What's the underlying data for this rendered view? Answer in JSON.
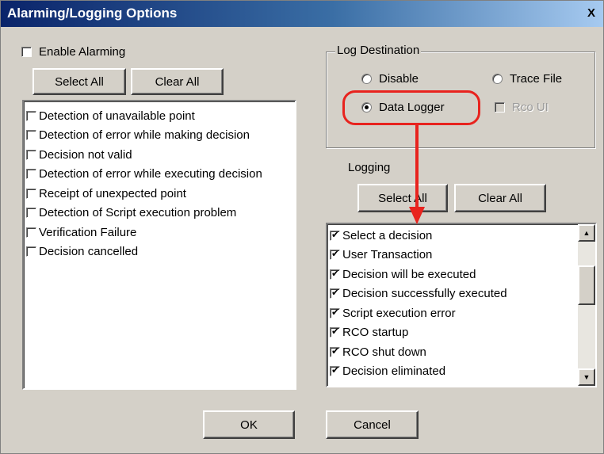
{
  "window": {
    "title": "Alarming/Logging Options",
    "close_glyph": "X"
  },
  "alarming": {
    "enable_label": "Enable Alarming",
    "enable_checked": false,
    "select_all_label": "Select All",
    "clear_all_label": "Clear All",
    "items": [
      {
        "label": "Detection of unavailable point",
        "checked": false
      },
      {
        "label": "Detection of error while making decision",
        "checked": false
      },
      {
        "label": "Decision not valid",
        "checked": false
      },
      {
        "label": "Detection of error while executing decision",
        "checked": false
      },
      {
        "label": "Receipt of unexpected point",
        "checked": false
      },
      {
        "label": "Detection of Script execution problem",
        "checked": false
      },
      {
        "label": "Verification Failure",
        "checked": false
      },
      {
        "label": "Decision cancelled",
        "checked": false
      }
    ]
  },
  "log_destination": {
    "group_label": "Log Destination",
    "options": {
      "disable": {
        "label": "Disable",
        "selected": false
      },
      "trace_file": {
        "label": "Trace File",
        "selected": false
      },
      "data_logger": {
        "label": "Data Logger",
        "selected": true
      }
    },
    "rco_ui": {
      "label": "Rco UI",
      "checked": false,
      "enabled": false
    }
  },
  "logging": {
    "label": "Logging",
    "select_all_label": "Select All",
    "clear_all_label": "Clear All",
    "items": [
      {
        "label": "Select a decision",
        "checked": true
      },
      {
        "label": "User Transaction",
        "checked": true
      },
      {
        "label": "Decision will be executed",
        "checked": true
      },
      {
        "label": "Decision successfully executed",
        "checked": true
      },
      {
        "label": "Script execution error",
        "checked": true
      },
      {
        "label": "RCO startup",
        "checked": true
      },
      {
        "label": "RCO shut down",
        "checked": true
      },
      {
        "label": "Decision eliminated",
        "checked": true
      }
    ]
  },
  "footer": {
    "ok_label": "OK",
    "cancel_label": "Cancel"
  },
  "colors": {
    "title_start": "#0a246a",
    "title_end": "#a6caf0",
    "face": "#d4d0c8",
    "annotation": "#e8231e"
  }
}
